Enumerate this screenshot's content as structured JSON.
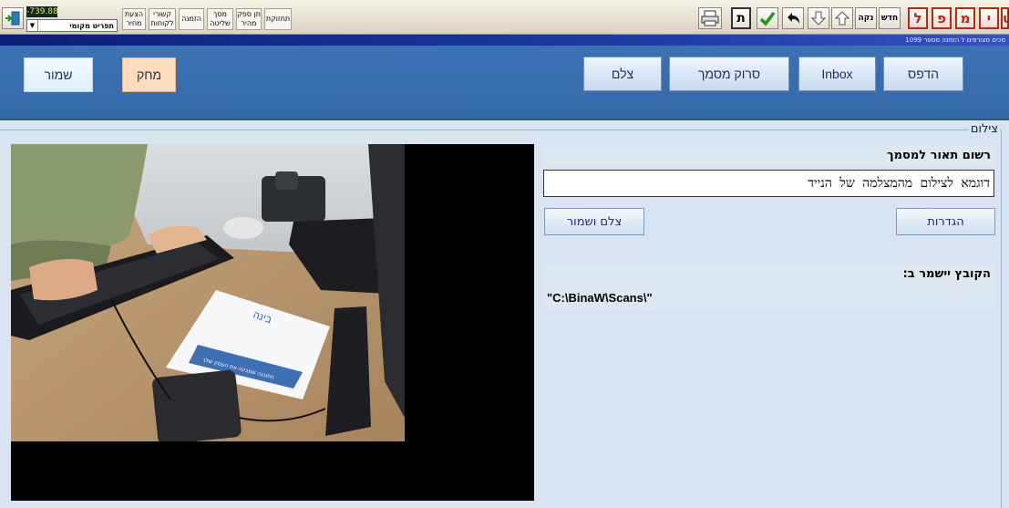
{
  "toolbar": {
    "balance": "-739.88",
    "local_detail": "תפריט מקומי",
    "small_buttons": [
      "הצעת מחיר",
      "קשורי לקוחות",
      "הזמנה",
      "מסך שליטה",
      "תן ספק מהיר",
      "תחזוקת"
    ],
    "new_label": "חדש",
    "clean_label": "נקה",
    "tav_label": "ת",
    "letter_buttons": [
      "ל",
      "פ",
      "מ",
      "י",
      "ט"
    ]
  },
  "strip": {
    "text": "מכים מצורפים ל הזמנה מספר 1099"
  },
  "header": {
    "save_label": "שמור",
    "delete_label": "מחק",
    "capture_label": "צלם",
    "scan_label": "סרוק מסמך",
    "inbox_label": "Inbox",
    "print_label": "הדפס"
  },
  "section": {
    "label": "צילום"
  },
  "panel": {
    "desc_label": "רשום תאור למסמך",
    "desc_value": "דוגמא לצילום מהמצלמה של הנייד",
    "settings_label": "הגדרות",
    "capture_save_label": "צלם ושמור",
    "save_to_label": "הקובץ יישמר ב:",
    "save_path": "\"C:\\BinaW\\Scans\\\""
  },
  "camera": {
    "booklet_title": "בינה",
    "booklet_tagline": "התוכנה שמבינה את העסק שלך"
  },
  "colors": {
    "header_bg": "#3b72b4",
    "body_bg": "#d8e4f2",
    "accent_red": "#b52a14",
    "green_check": "#1a9a18"
  }
}
